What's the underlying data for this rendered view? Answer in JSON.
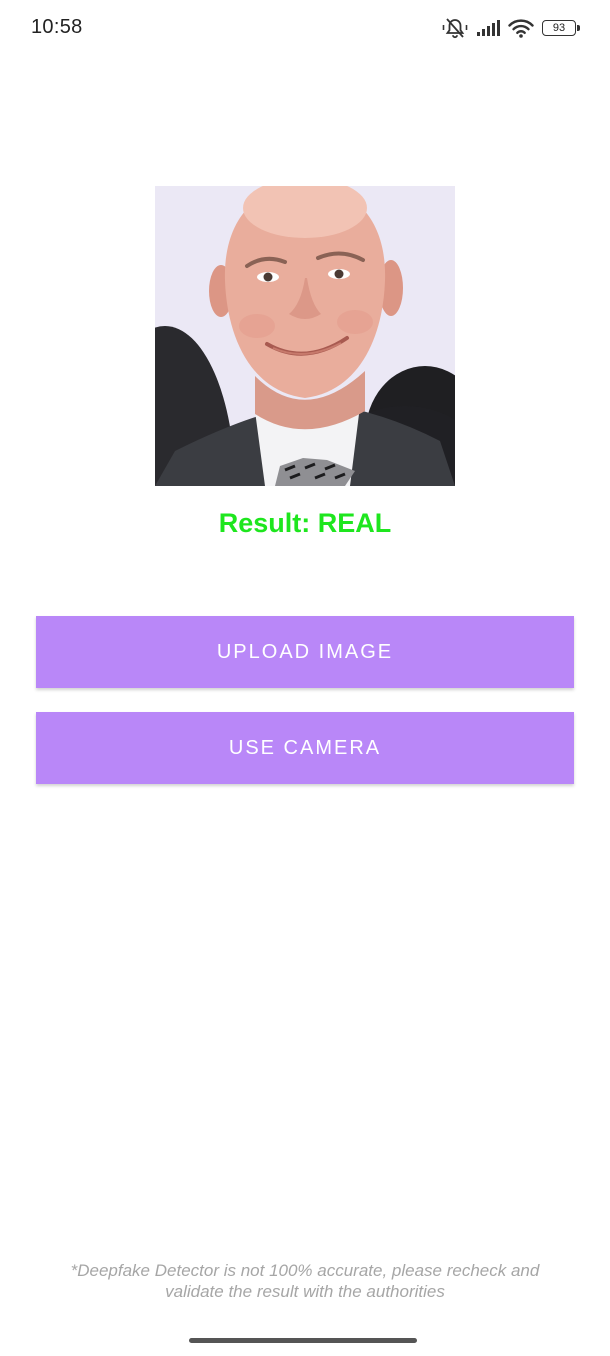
{
  "status_bar": {
    "time": "10:58",
    "icons": [
      "mute-icon",
      "signal-icon",
      "wifi-icon",
      "battery-icon"
    ],
    "battery_level": "93"
  },
  "photo": {
    "icon": "face-photo"
  },
  "result": {
    "text": "Result: REAL",
    "color": "#1ee61e"
  },
  "buttons": {
    "upload_label": "UPLOAD IMAGE",
    "camera_label": "USE CAMERA",
    "color": "#b987f8"
  },
  "disclaimer": {
    "line1": "*Deepfake Detector is not 100% accurate, please recheck and",
    "line2": "validate the result with the authorities"
  }
}
